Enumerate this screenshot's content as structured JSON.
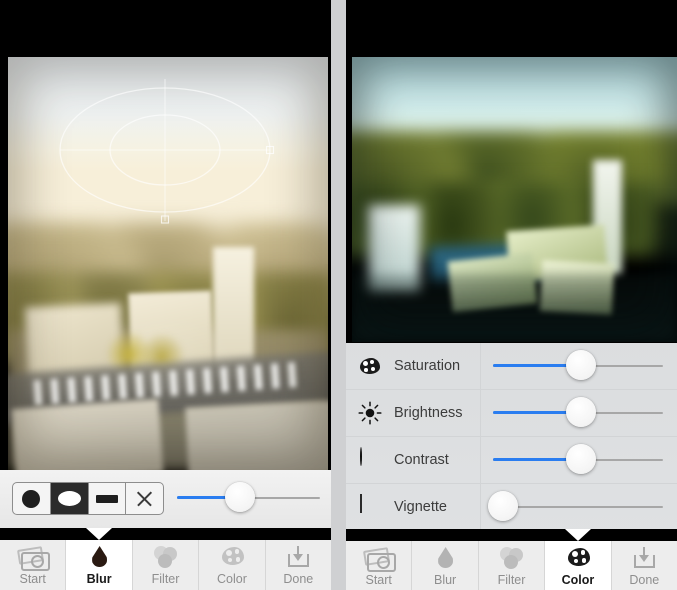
{
  "app": {
    "left_panel_mode": "Blur",
    "right_panel_mode": "Color"
  },
  "left": {
    "photo": {
      "alt": "aerial-cityscape-tilt-shift-warm"
    },
    "blur_toolbar": {
      "shapes": [
        {
          "name": "circle-blur-shape",
          "icon": "circle-icon",
          "selected": false
        },
        {
          "name": "ellipse-blur-shape",
          "icon": "ellipse-icon",
          "selected": true
        },
        {
          "name": "linear-blur-shape",
          "icon": "bar-icon",
          "selected": false
        },
        {
          "name": "no-blur-shape",
          "icon": "close-x-icon",
          "selected": false
        }
      ],
      "blur_slider": {
        "name": "blur-amount-slider",
        "value": 44,
        "min": 0,
        "max": 100
      }
    },
    "tabs": [
      {
        "label": "Start",
        "icon": "camera-icon",
        "active": false
      },
      {
        "label": "Blur",
        "icon": "droplet-icon",
        "active": true
      },
      {
        "label": "Filter",
        "icon": "circles-icon",
        "active": false
      },
      {
        "label": "Color",
        "icon": "palette-icon",
        "active": false
      },
      {
        "label": "Done",
        "icon": "download-icon",
        "active": false
      }
    ]
  },
  "right": {
    "photo": {
      "alt": "aerial-cityscape-tilt-shift-teal-yellow"
    },
    "adjustments": [
      {
        "label": "Saturation",
        "icon": "palette-icon",
        "value": 52,
        "min": 0,
        "max": 100
      },
      {
        "label": "Brightness",
        "icon": "sun-icon",
        "value": 52,
        "min": 0,
        "max": 100
      },
      {
        "label": "Contrast",
        "icon": "contrast-icon",
        "value": 52,
        "min": 0,
        "max": 100
      },
      {
        "label": "Vignette",
        "icon": "vignette-icon",
        "value": 6,
        "min": 0,
        "max": 100
      }
    ],
    "tabs": [
      {
        "label": "Start",
        "icon": "camera-icon",
        "active": false
      },
      {
        "label": "Blur",
        "icon": "droplet-icon",
        "active": false
      },
      {
        "label": "Filter",
        "icon": "circles-icon",
        "active": false
      },
      {
        "label": "Color",
        "icon": "palette-icon",
        "active": true
      },
      {
        "label": "Done",
        "icon": "download-icon",
        "active": false
      }
    ]
  },
  "colors": {
    "accent_blue": "#2a7df0",
    "tab_inactive_text": "#8e8e8e",
    "tab_active_text": "#1a1a1a",
    "toolbar_bg": "#ededed",
    "divider": "#cfd0d2"
  }
}
